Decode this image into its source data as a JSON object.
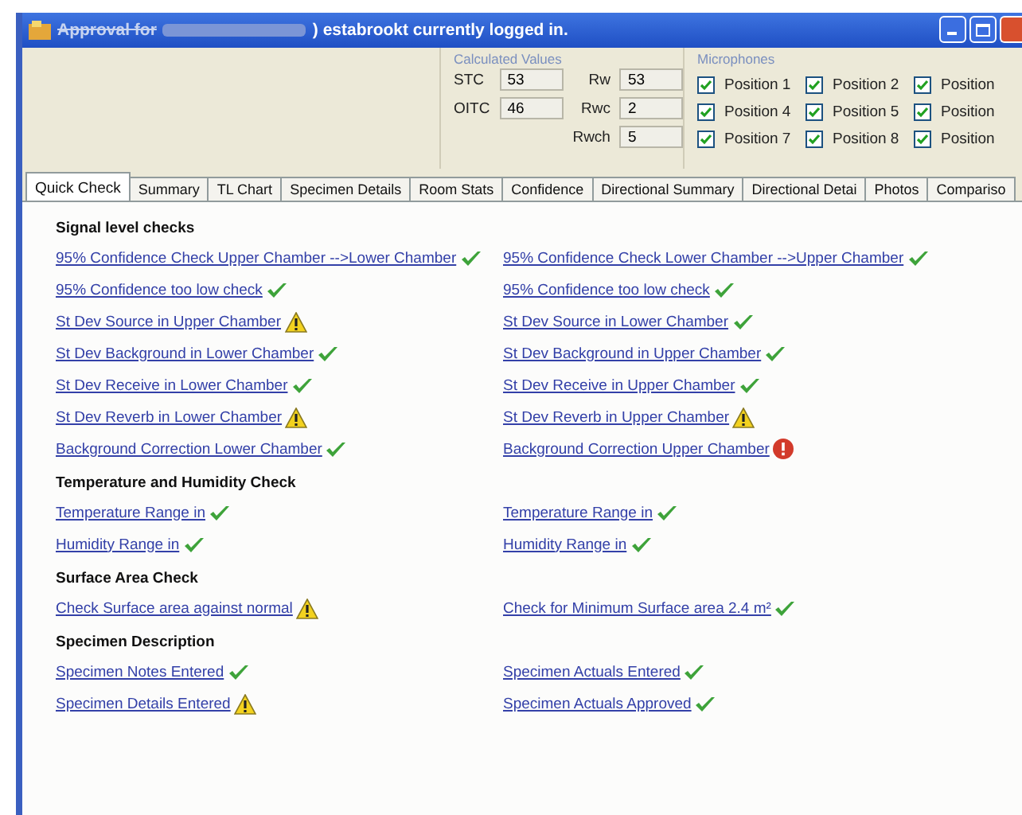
{
  "window": {
    "title_prefix": "Approval for",
    "title_suffix": ") estabrookt currently logged in."
  },
  "calculated_values": {
    "legend": "Calculated Values",
    "fields": [
      {
        "label": "STC",
        "value": "53"
      },
      {
        "label": "Rw",
        "value": "53"
      },
      {
        "label": "OITC",
        "value": "46"
      },
      {
        "label": "Rwc",
        "value": "2"
      },
      {
        "label": "Rwch",
        "value": "5"
      }
    ]
  },
  "microphones": {
    "legend": "Microphones",
    "items": [
      {
        "label": "Position 1",
        "checked": true
      },
      {
        "label": "Position 2",
        "checked": true
      },
      {
        "label": "Position",
        "checked": true
      },
      {
        "label": "Position 4",
        "checked": true
      },
      {
        "label": "Position 5",
        "checked": true
      },
      {
        "label": "Position",
        "checked": true
      },
      {
        "label": "Position 7",
        "checked": true
      },
      {
        "label": "Position 8",
        "checked": true
      },
      {
        "label": "Position",
        "checked": true
      }
    ]
  },
  "tabs": [
    {
      "label": "Quick Check",
      "selected": true
    },
    {
      "label": "Summary",
      "selected": false
    },
    {
      "label": "TL Chart",
      "selected": false
    },
    {
      "label": "Specimen Details",
      "selected": false
    },
    {
      "label": "Room Stats",
      "selected": false
    },
    {
      "label": "Confidence",
      "selected": false
    },
    {
      "label": "Directional Summary",
      "selected": false
    },
    {
      "label": "Directional Detai",
      "selected": false
    },
    {
      "label": "Photos",
      "selected": false
    },
    {
      "label": "Compariso",
      "selected": false
    }
  ],
  "sections": [
    {
      "title": "Signal level checks",
      "rows": [
        [
          {
            "text": "95% Confidence Check Upper Chamber -->Lower Chamber",
            "kind": "ok"
          },
          {
            "text": "95% Confidence Check Lower Chamber -->Upper Chamber",
            "kind": "ok"
          }
        ],
        [
          {
            "text": "95% Confidence too low check",
            "kind": "ok"
          },
          {
            "text": "95% Confidence too low check",
            "kind": "ok"
          }
        ],
        [
          {
            "text": "St Dev Source in Upper Chamber",
            "kind": "warning"
          },
          {
            "text": "St Dev Source in Lower Chamber",
            "kind": "ok"
          }
        ],
        [
          {
            "text": "St Dev Background in Lower Chamber",
            "kind": "ok"
          },
          {
            "text": "St Dev Background in Upper Chamber",
            "kind": "ok"
          }
        ],
        [
          {
            "text": "St Dev Receive in Lower Chamber",
            "kind": "ok"
          },
          {
            "text": "St Dev Receive in Upper Chamber",
            "kind": "ok"
          }
        ],
        [
          {
            "text": "St Dev Reverb in  Lower Chamber",
            "kind": "warning"
          },
          {
            "text": "St Dev Reverb in  Upper Chamber",
            "kind": "warning"
          }
        ],
        [
          {
            "text": "Background Correction Lower Chamber",
            "kind": "ok"
          },
          {
            "text": "Background Correction Upper Chamber",
            "kind": "error"
          }
        ]
      ]
    },
    {
      "title": "Temperature and Humidity Check",
      "rows": [
        [
          {
            "text": "Temperature Range in",
            "kind": "ok"
          },
          {
            "text": "Temperature Range in",
            "kind": "ok"
          }
        ],
        [
          {
            "text": "Humidity Range in",
            "kind": "ok"
          },
          {
            "text": "Humidity Range in",
            "kind": "ok"
          }
        ]
      ]
    },
    {
      "title": "Surface Area Check",
      "rows": [
        [
          {
            "text": "Check Surface area against normal",
            "kind": "warning"
          },
          {
            "text": "Check for Minimum Surface area 2.4 m²",
            "kind": "ok"
          }
        ]
      ]
    },
    {
      "title": "Specimen Description",
      "rows": [
        [
          {
            "text": "Specimen Notes Entered",
            "kind": "ok"
          },
          {
            "text": "Specimen Actuals Entered",
            "kind": "ok"
          }
        ],
        [
          {
            "text": "Specimen Details Entered",
            "kind": "warning"
          },
          {
            "text": "Specimen Actuals Approved",
            "kind": "ok"
          }
        ]
      ]
    }
  ]
}
